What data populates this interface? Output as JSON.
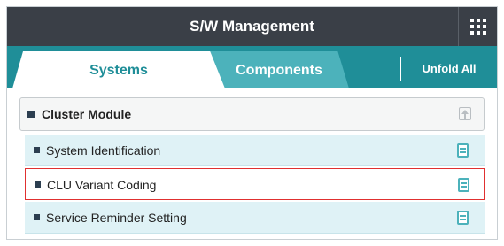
{
  "header": {
    "title": "S/W Management",
    "menu_icon": "grid-icon"
  },
  "tabs": [
    {
      "label": "Systems",
      "active": true
    },
    {
      "label": "Components",
      "active": false
    }
  ],
  "toolbar": {
    "unfold_label": "Unfold All"
  },
  "group": {
    "label": "Cluster Module",
    "icon": "upload-icon",
    "items": [
      {
        "label": "System Identification",
        "icon": "document-icon",
        "selected": false
      },
      {
        "label": "CLU Variant Coding",
        "icon": "document-icon",
        "selected": true
      },
      {
        "label": "Service Reminder Setting",
        "icon": "document-icon",
        "selected": false
      }
    ]
  },
  "colors": {
    "header": "#3a3f47",
    "accent": "#1f8e98",
    "row": "#dff2f6",
    "selection": "#e03030"
  }
}
